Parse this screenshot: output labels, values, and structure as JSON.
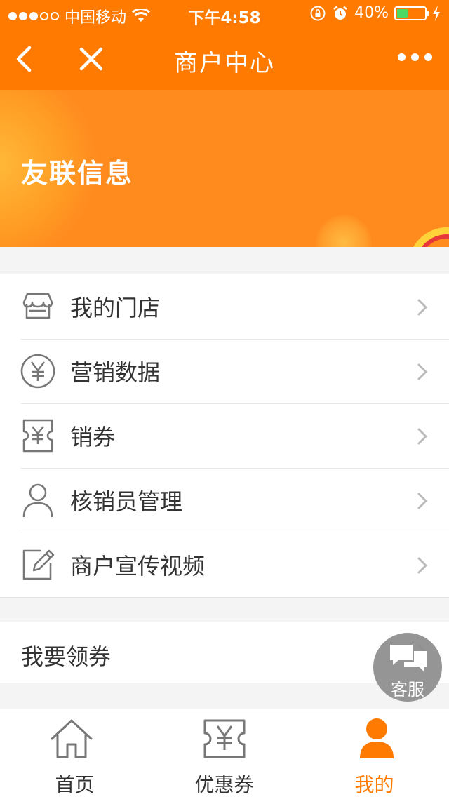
{
  "status_bar": {
    "carrier": "中国移动",
    "time": "下午4:58",
    "battery": "40%",
    "battery_level": 0.4,
    "signal_bars_filled": 3,
    "signal_bars_total": 5
  },
  "nav": {
    "title": "商户中心",
    "back_icon": "chevron-left-icon",
    "close_icon": "close-icon",
    "more_icon": "more-dots-icon"
  },
  "banner": {
    "merchant_name": "友联信息"
  },
  "menu": {
    "items": [
      {
        "label": "我的门店",
        "icon": "store-icon"
      },
      {
        "label": "营销数据",
        "icon": "yen-circle-icon"
      },
      {
        "label": "销券",
        "icon": "coupon-icon"
      },
      {
        "label": "核销员管理",
        "icon": "person-icon"
      },
      {
        "label": "商户宣传视频",
        "icon": "edit-icon"
      }
    ]
  },
  "secondary": {
    "label": "我要领券"
  },
  "service": {
    "label": "客服",
    "icon": "chat-bubbles-icon"
  },
  "tabbar": {
    "tabs": [
      {
        "label": "首页",
        "icon": "home-icon",
        "active": false
      },
      {
        "label": "优惠券",
        "icon": "coupon-icon",
        "active": false
      },
      {
        "label": "我的",
        "icon": "person-filled-icon",
        "active": true
      }
    ]
  },
  "colors": {
    "brand": "#ff7a00",
    "active_tab": "#ff7a00",
    "icon_gray": "#777777",
    "battery_green": "#4cd964"
  }
}
